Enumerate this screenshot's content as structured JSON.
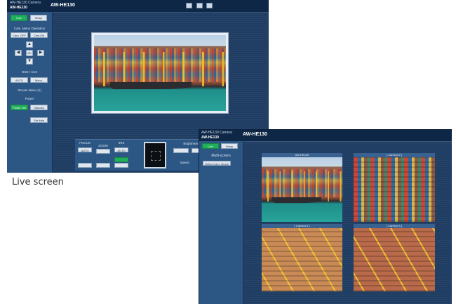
{
  "caption": "Live screen",
  "live_window": {
    "header": {
      "subtitle": "AW-HE130 Camera",
      "camera_name": "AW-HE130",
      "model": "AW-HE130"
    },
    "tabs": [
      "Live",
      "Setup"
    ],
    "panel": {
      "camera_menu_title": "Cam. Menu Operation",
      "cam_off": "Cam. OFF",
      "cam_on": "Cam.ON",
      "arrows": {
        "up": "▲",
        "down": "▼",
        "left": "◀",
        "right": "▶",
        "center": "OK"
      },
      "cancel": "Cancel",
      "osd_title": "OSD / AUX",
      "auto_label": "AUTO",
      "manual_label": "Manu.",
      "stream_menu": "Stream Menu (1)",
      "power_title": "Power",
      "power_on": "Power ON",
      "standby": "Standby",
      "set_label": "Set date"
    },
    "bottom": {
      "focus_title": "FOCUS",
      "zoom_title": "ZOOM",
      "iris_title": "IRIS",
      "focus_btn": "AUTO",
      "iris_btn": "AUTO",
      "brightness_title": "Brightness",
      "speed_label": "Speed",
      "auto_btn": "AUTO"
    }
  },
  "multi_window": {
    "header": {
      "subtitle": "AW-HE130 Camera",
      "camera_name": "AW-HE130",
      "model": "AW-HE130"
    },
    "tabs": [
      "Live",
      "Setup"
    ],
    "panel": {
      "title": "Multi-screen",
      "select_btn": "Select Cam. Group"
    },
    "tiles": [
      "AW-HE130",
      "[ Camera 2 ]",
      "[ Camera 3 ]",
      "[ Camera 4 ]"
    ]
  },
  "colors": {
    "bg": "#1f3d63",
    "header": "#0e2747",
    "active_tab": "#20b05a"
  }
}
